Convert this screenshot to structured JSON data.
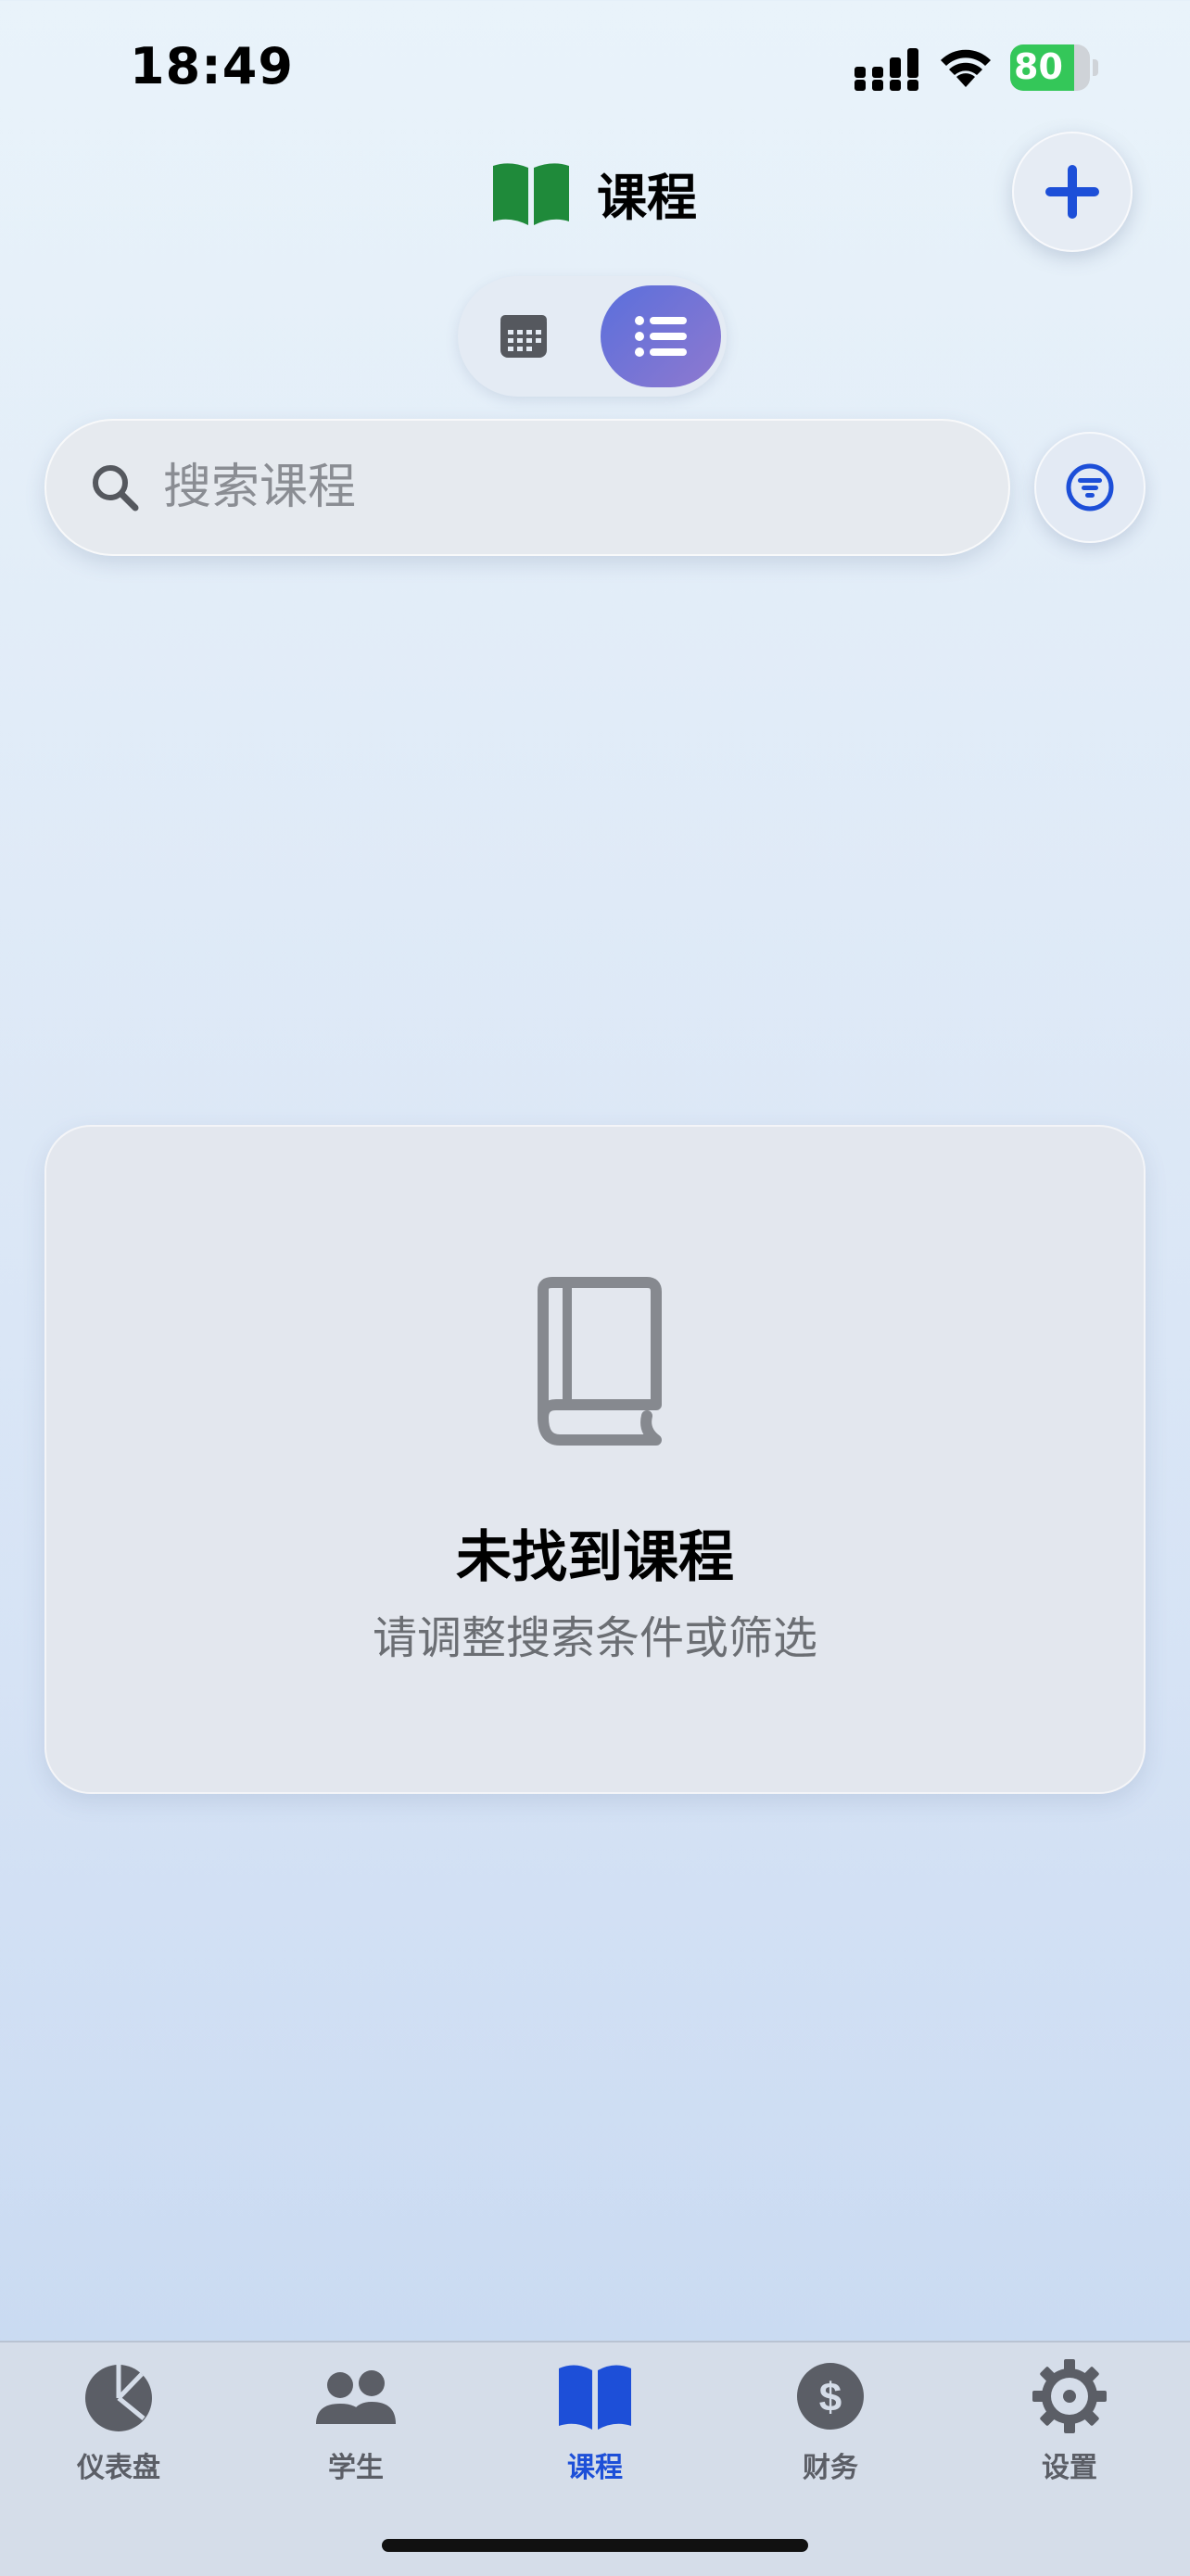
{
  "status_bar": {
    "time": "18:49",
    "battery_level": 80,
    "battery_label": "80"
  },
  "header": {
    "title": "课程"
  },
  "view_toggle": {
    "options": [
      "calendar",
      "list"
    ],
    "selected": "list"
  },
  "search": {
    "placeholder": "搜索课程",
    "value": ""
  },
  "empty_state": {
    "title": "未找到课程",
    "subtitle": "请调整搜索条件或筛选"
  },
  "tab_bar": {
    "items": [
      {
        "label": "仪表盘",
        "icon": "pie-chart-icon"
      },
      {
        "label": "学生",
        "icon": "people-icon"
      },
      {
        "label": "课程",
        "icon": "book-icon"
      },
      {
        "label": "财务",
        "icon": "dollar-icon"
      },
      {
        "label": "设置",
        "icon": "gear-icon"
      }
    ],
    "active": "课程"
  },
  "colors": {
    "accent": "#1d4fd8",
    "toggle_gradient_start": "#5a6fdc",
    "toggle_gradient_end": "#8f79cf",
    "book_green": "#1f8a3a",
    "battery_green": "#34c759",
    "inactive_tab": "#5b5e66"
  }
}
